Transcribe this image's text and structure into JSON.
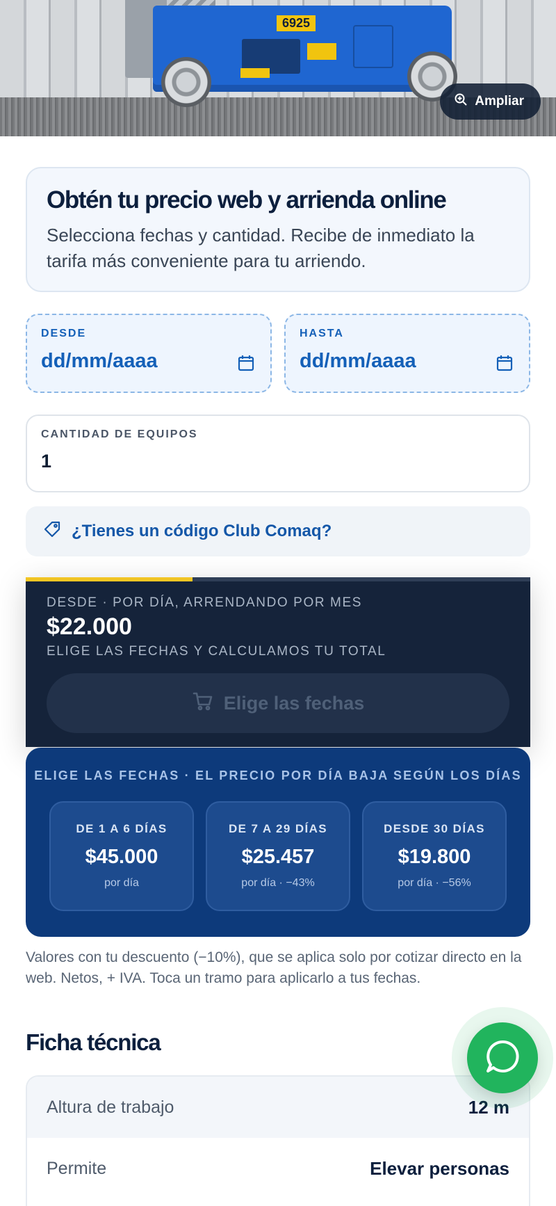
{
  "hero": {
    "zoom_label": "Ampliar",
    "machine_number": "6925"
  },
  "intro": {
    "title": "Obtén tu precio web y arrienda online",
    "description": "Selecciona fechas y cantidad. Recibe de inmediato la tarifa más conveniente para tu arriendo."
  },
  "dates": {
    "from_label": "DESDE",
    "from_value": "dd/mm/aaaa",
    "to_label": "HASTA",
    "to_value": "dd/mm/aaaa"
  },
  "quantity": {
    "label": "CANTIDAD DE EQUIPOS",
    "value": "1"
  },
  "promo": {
    "label": "¿Tienes un código Club Comaq?"
  },
  "price": {
    "from_label": "DESDE · POR DÍA, ARRENDANDO POR MES",
    "amount": "$22.000",
    "hint": "ELIGE LAS FECHAS Y CALCULAMOS TU TOTAL",
    "cta_label": "Elige las fechas",
    "accent_color": "#f2c523"
  },
  "tiers": {
    "title": "ELIGE LAS FECHAS · EL PRECIO POR DÍA BAJA SEGÚN LOS DÍAS",
    "items": [
      {
        "range": "DE 1 A 6 DÍAS",
        "price": "$45.000",
        "per": "por día"
      },
      {
        "range": "DE 7 A 29 DÍAS",
        "price": "$25.457",
        "per": "por día · −43%"
      },
      {
        "range": "DESDE 30 DÍAS",
        "price": "$19.800",
        "per": "por día · −56%"
      }
    ]
  },
  "footnote": "Valores con tu descuento (−10%), que se aplica solo por cotizar directo en la web. Netos, + IVA. Toca un tramo para aplicarlo a tus fechas.",
  "specs": {
    "title": "Ficha técnica",
    "rows": [
      {
        "key": "Altura de trabajo",
        "value": "12 m"
      },
      {
        "key": "Permite",
        "value": "Elevar personas"
      }
    ]
  },
  "whatsapp": {
    "icon": "whatsapp-icon",
    "color": "#21b45d"
  }
}
